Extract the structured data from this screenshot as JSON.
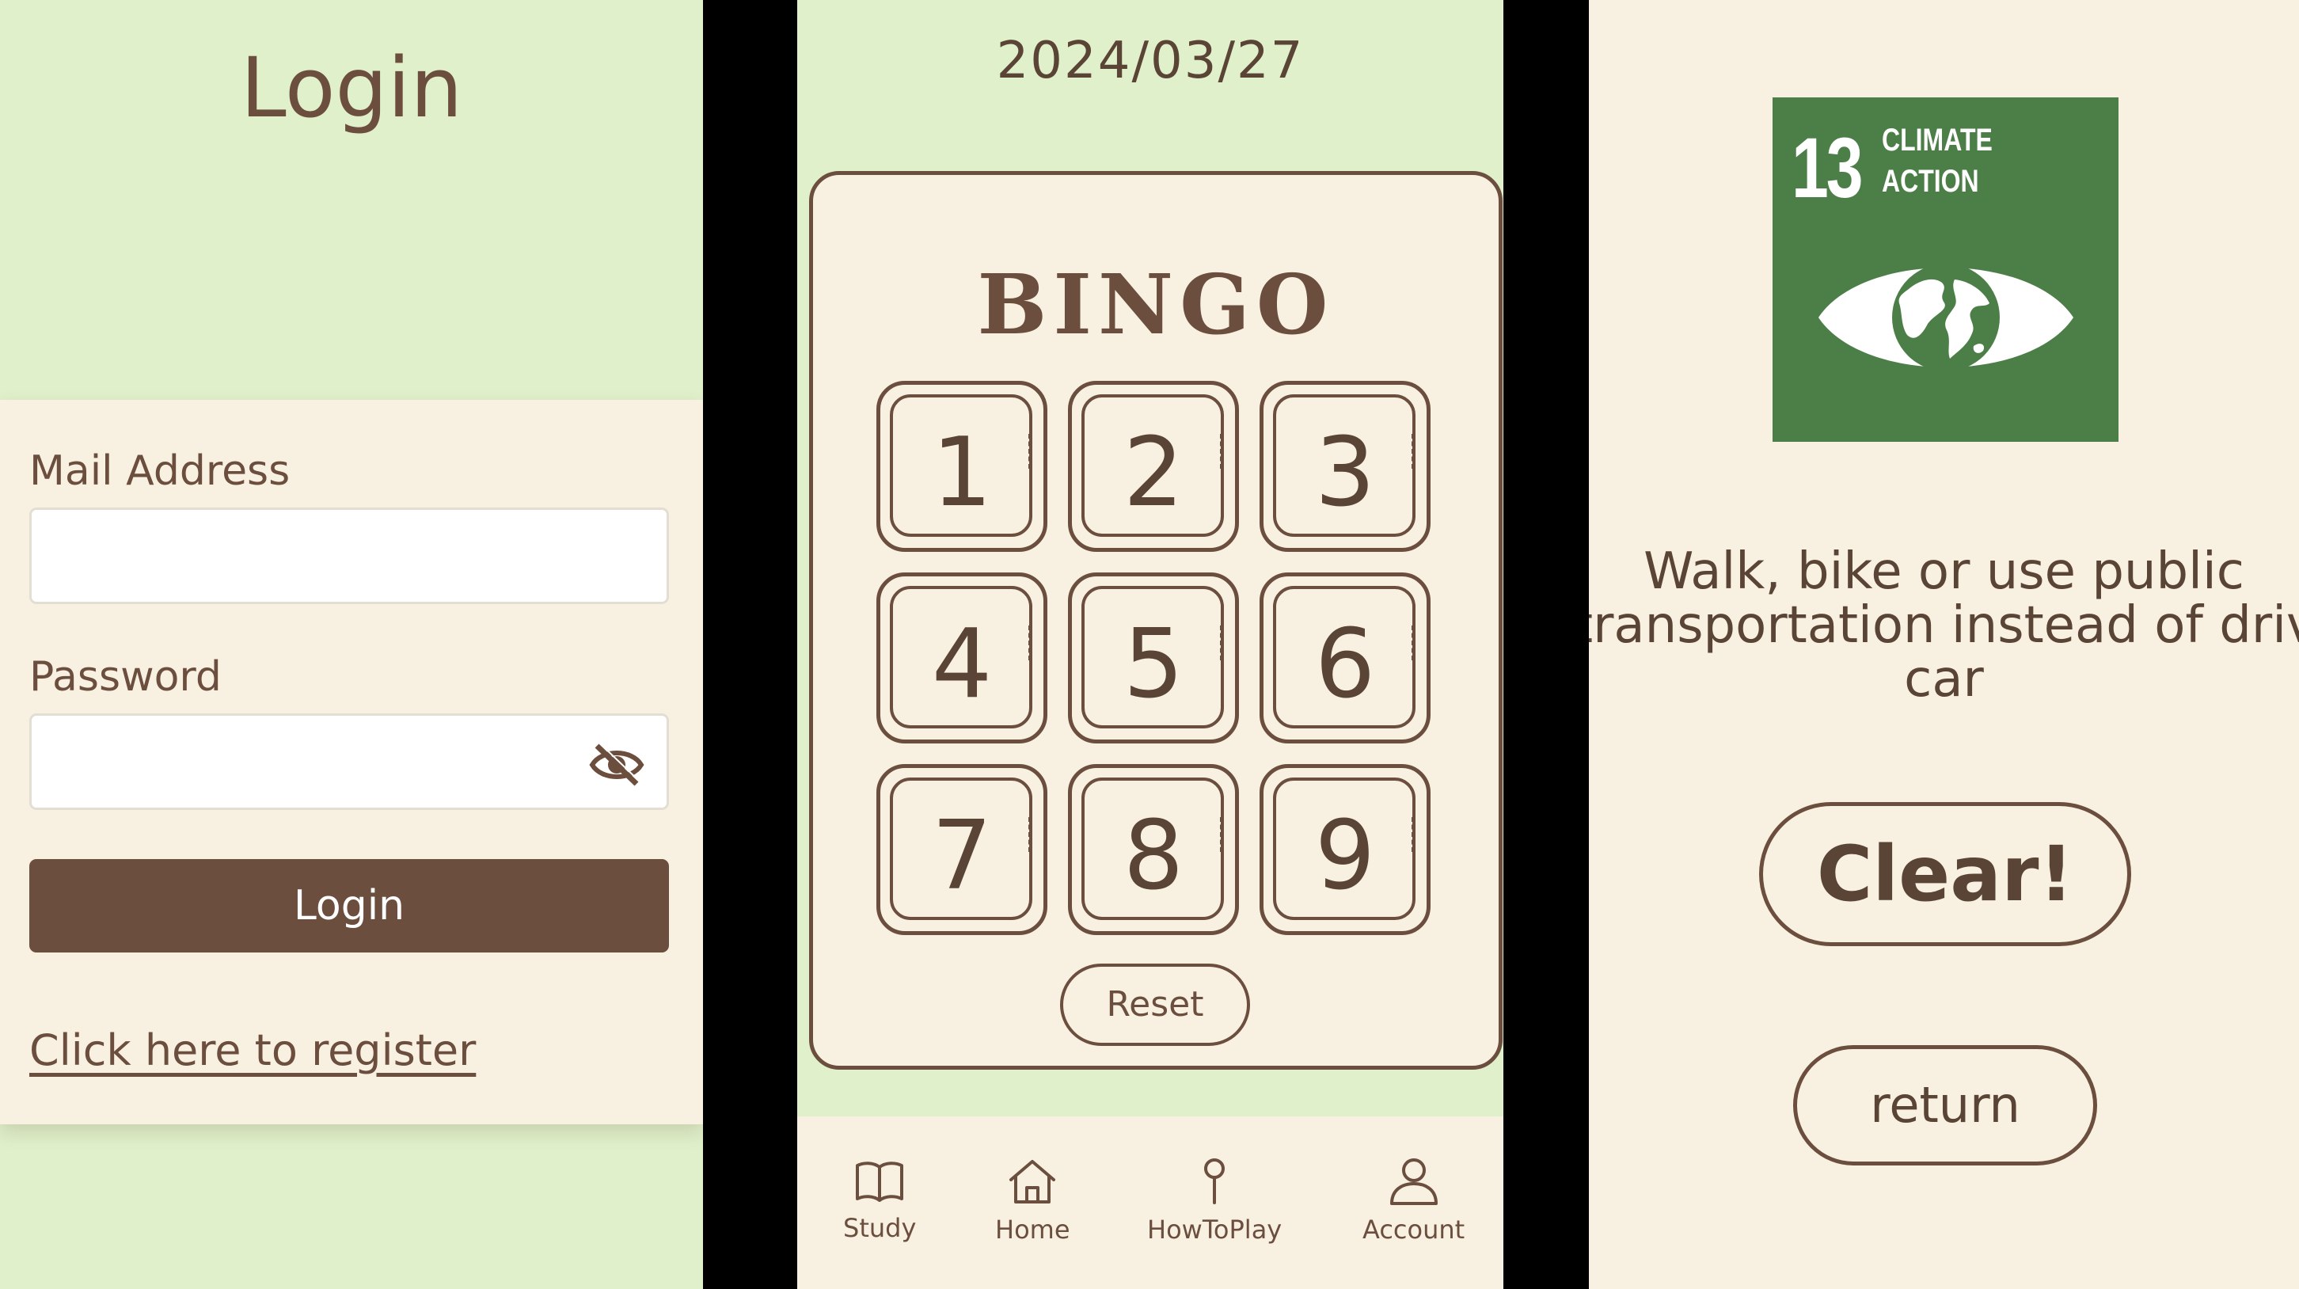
{
  "login": {
    "title": "Login",
    "mail_label": "Mail Address",
    "mail_value": "",
    "password_label": "Password",
    "password_value": "",
    "login_button": "Login",
    "register_link": "Click here to register"
  },
  "bingo": {
    "date": "2024/03/27",
    "title": "BINGO",
    "cells": [
      "1",
      "2",
      "3",
      "4",
      "5",
      "6",
      "7",
      "8",
      "9"
    ],
    "reset_button": "Reset",
    "nav": [
      {
        "label": "Study",
        "icon": "book-icon"
      },
      {
        "label": "Home",
        "icon": "home-icon"
      },
      {
        "label": "HowToPlay",
        "icon": "pin-icon"
      },
      {
        "label": "Account",
        "icon": "user-icon"
      }
    ]
  },
  "result": {
    "sdg_number": "13",
    "sdg_label_line1": "CLIMATE",
    "sdg_label_line2": "ACTION",
    "text_line1": "Walk, bike or use public",
    "text_line2": "transportation instead of driving",
    "text_line3": "car",
    "clear_button": "Clear!",
    "return_button": "return"
  },
  "colors": {
    "green_bg": "#e0f0ca",
    "cream_bg": "#f8f1e2",
    "brown": "#6b4e3d",
    "sdg_green": "#4c7f48"
  }
}
